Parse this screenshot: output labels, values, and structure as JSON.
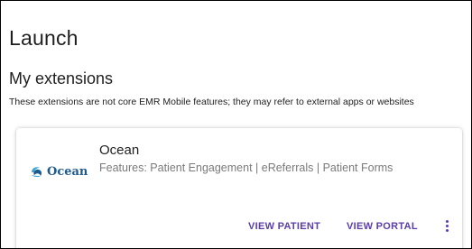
{
  "page": {
    "title": "Launch"
  },
  "section": {
    "title": "My extensions",
    "description": "These extensions are not core EMR Mobile features; they may refer to external apps or websites"
  },
  "extension": {
    "logo_text": "Ocean",
    "logo_icon": "ocean-logo-icon",
    "name": "Ocean",
    "features": "Features: Patient Engagement | eReferrals | Patient Forms",
    "actions": {
      "view_patient": "VIEW PATIENT",
      "view_portal": "VIEW PORTAL"
    },
    "more_icon": "more-vertical-icon"
  },
  "colors": {
    "accent": "#5b3ea6",
    "logo_blue": "#1e5a8c",
    "logo_light_blue": "#3aa6d9",
    "text_primary": "#1f1f1f",
    "text_secondary": "#7a7a7a"
  }
}
